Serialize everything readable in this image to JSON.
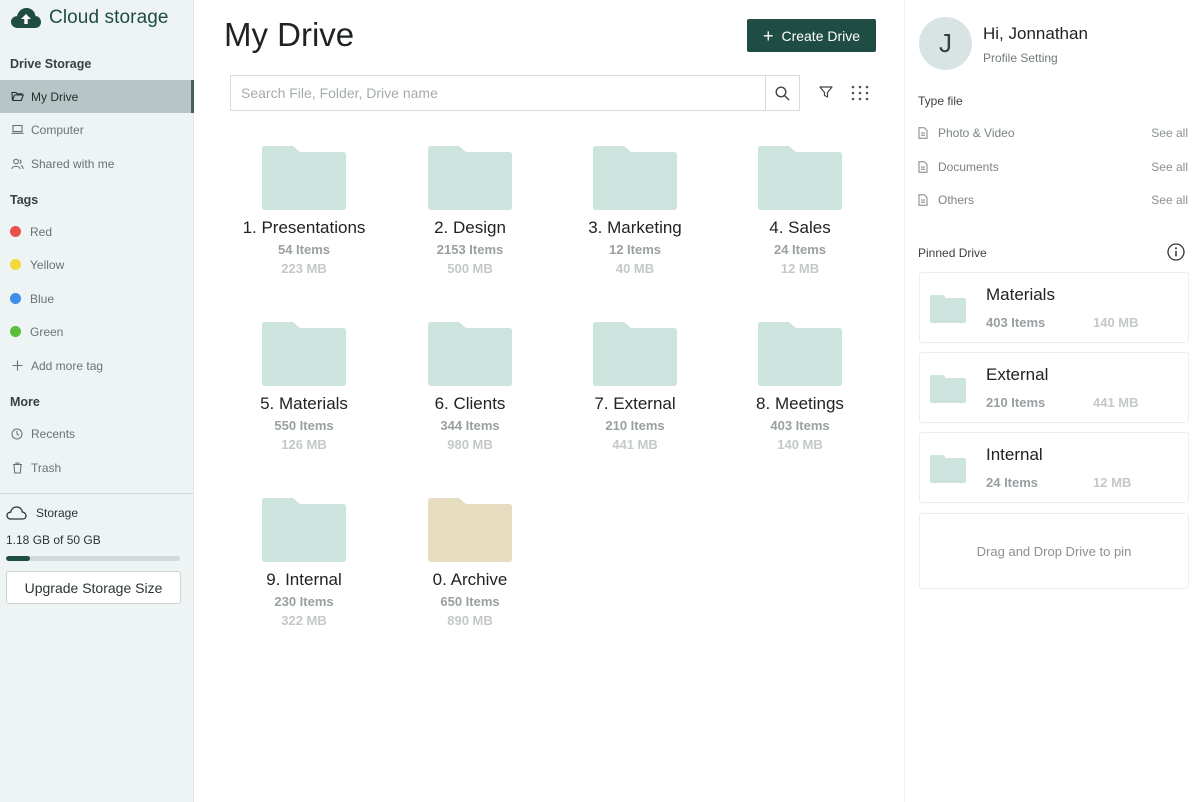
{
  "brand": {
    "name": "Cloud storage"
  },
  "sidebar": {
    "drive_storage_title": "Drive Storage",
    "nav": [
      {
        "label": "My Drive",
        "icon": "folder-open-icon",
        "active": true
      },
      {
        "label": "Computer",
        "icon": "laptop-icon",
        "active": false
      },
      {
        "label": "Shared with me",
        "icon": "shared-users-icon",
        "active": false
      }
    ],
    "tags_title": "Tags",
    "tags": [
      {
        "label": "Red",
        "color": "#e8504a"
      },
      {
        "label": "Yellow",
        "color": "#f3d93a"
      },
      {
        "label": "Blue",
        "color": "#3d8ee8"
      },
      {
        "label": "Green",
        "color": "#5cbd3a"
      }
    ],
    "add_tag_label": "Add more tag",
    "more_title": "More",
    "more": [
      {
        "label": "Recents",
        "icon": "clock-icon"
      },
      {
        "label": "Trash",
        "icon": "trash-icon"
      }
    ],
    "storage": {
      "title": "Storage",
      "used_text": "1.18 GB of 50 GB",
      "used_fraction": 0.14,
      "upgrade_label": "Upgrade Storage Size"
    }
  },
  "main": {
    "title": "My Drive",
    "create_label": "Create Drive",
    "search_placeholder": "Search File, Folder, Drive name",
    "folders": [
      {
        "name": "1. Presentations",
        "items": "54 Items",
        "size": "223 MB",
        "color": "#cde3dd"
      },
      {
        "name": "2. Design",
        "items": "2153 Items",
        "size": "500 MB",
        "color": "#cde3dd"
      },
      {
        "name": "3. Marketing",
        "items": "12 Items",
        "size": "40 MB",
        "color": "#cde3dd"
      },
      {
        "name": "4. Sales",
        "items": "24 Items",
        "size": "12 MB",
        "color": "#cde3dd"
      },
      {
        "name": "5. Materials",
        "items": "550 Items",
        "size": "126 MB",
        "color": "#cde3dd"
      },
      {
        "name": "6. Clients",
        "items": "344 Items",
        "size": "980 MB",
        "color": "#cde3dd"
      },
      {
        "name": "7. External",
        "items": "210 Items",
        "size": "441 MB",
        "color": "#cde3dd"
      },
      {
        "name": "8. Meetings",
        "items": "403 Items",
        "size": "140 MB",
        "color": "#cde3dd"
      },
      {
        "name": "9. Internal",
        "items": "230 Items",
        "size": "322 MB",
        "color": "#cde3dd"
      },
      {
        "name": "0. Archive",
        "items": "650 Items",
        "size": "890 MB",
        "color": "#e6dcbf"
      }
    ]
  },
  "profile": {
    "initial": "J",
    "greeting": "Hi, Jonnathan",
    "setting_label": "Profile Setting"
  },
  "type_file": {
    "title": "Type file",
    "rows": [
      {
        "label": "Photo & Video",
        "action": "See all"
      },
      {
        "label": "Documents",
        "action": "See all"
      },
      {
        "label": "Others",
        "action": "See all"
      }
    ]
  },
  "pinned": {
    "title": "Pinned Drive",
    "cards": [
      {
        "name": "Materials",
        "items": "403 Items",
        "size": "140 MB"
      },
      {
        "name": "External",
        "items": "210 Items",
        "size": "441 MB"
      },
      {
        "name": "Internal",
        "items": "24 Items",
        "size": "12 MB"
      }
    ],
    "drop_text": "Drag and Drop Drive to pin"
  },
  "colors": {
    "accent": "#1f4d44",
    "folder": "#cde3dd",
    "archive_folder": "#e6dcbf",
    "sidebar_bg": "#eef3f3"
  }
}
